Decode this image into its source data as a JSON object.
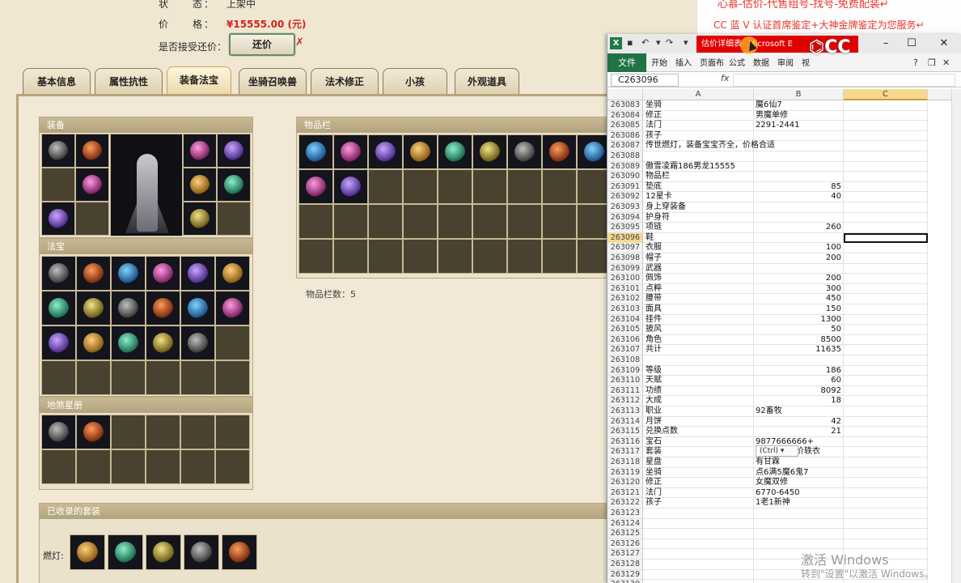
{
  "game": {
    "status_label": "状　　态：",
    "status_value": "上架中",
    "price_label": "价　　格：",
    "price_value": "¥15555.00 (元)",
    "counter_label": "是否接受还价：",
    "counter_button": "还价",
    "counter_x": "✗",
    "tabs": [
      "基本信息",
      "属性抗性",
      "装备法宝",
      "坐骑召唤兽",
      "法术修正",
      "小孩",
      "外观道具"
    ],
    "active_tab": 2,
    "panels": {
      "equip": "装备",
      "fabao": "法宝",
      "disha": "地煞星册",
      "bag": "物品栏",
      "sets": "已收录的套装"
    },
    "bag_count": "物品栏数：5",
    "sets_label": "燃灯:"
  },
  "ad": {
    "line1": "心慕-估价-代售组号-找号-免费配装↵",
    "line2": "CC 蓝 V 认证首席鉴定+大神金牌鉴定为您服务↵"
  },
  "excel": {
    "logo": "X",
    "title_part1": "估价详细表",
    "title_part2": "Microsoft E",
    "ribbon_file": "文件",
    "ribbon_tabs": [
      "开始",
      "插入",
      "页面布",
      "公式",
      "数据",
      "审阅",
      "视"
    ],
    "namebox": "C263096",
    "fx": "fx",
    "col_a": "A",
    "col_b": "B",
    "col_c": "C",
    "ctrl_tag": "(Ctrl) ▾",
    "rows": [
      {
        "n": "263083",
        "a": "坐骑",
        "b": "魔6仙7"
      },
      {
        "n": "263084",
        "a": "修正",
        "b": "男魔单修"
      },
      {
        "n": "263085",
        "a": "法门",
        "b": "2291-2441"
      },
      {
        "n": "263086",
        "a": "孩子",
        "b": ""
      },
      {
        "n": "263087",
        "a": "传世燃灯，装备宝宝齐全，价格合适",
        "b": ""
      },
      {
        "n": "263088",
        "a": "",
        "b": ""
      },
      {
        "n": "263089",
        "a": "傲雪凌霜186男龙15555",
        "b": ""
      },
      {
        "n": "263090",
        "a": "物品栏",
        "b": ""
      },
      {
        "n": "263091",
        "a": "垫底",
        "b": "85"
      },
      {
        "n": "263092",
        "a": "12星卡",
        "b": "40"
      },
      {
        "n": "263093",
        "a": "身上穿装备",
        "b": ""
      },
      {
        "n": "263094",
        "a": "护身符",
        "b": ""
      },
      {
        "n": "263095",
        "a": "项链",
        "b": "260"
      },
      {
        "n": "263096",
        "a": "鞋",
        "b": ""
      },
      {
        "n": "263097",
        "a": "衣服",
        "b": "100"
      },
      {
        "n": "263098",
        "a": "帽子",
        "b": "200"
      },
      {
        "n": "263099",
        "a": "武器",
        "b": ""
      },
      {
        "n": "263100",
        "a": "佩饰",
        "b": "200"
      },
      {
        "n": "263101",
        "a": "点粹",
        "b": "300"
      },
      {
        "n": "263102",
        "a": "腰带",
        "b": "450"
      },
      {
        "n": "263103",
        "a": "面具",
        "b": "150"
      },
      {
        "n": "263104",
        "a": "挂件",
        "b": "1300"
      },
      {
        "n": "263105",
        "a": "披风",
        "b": "50"
      },
      {
        "n": "263106",
        "a": "角色",
        "b": "8500"
      },
      {
        "n": "263107",
        "a": "共计",
        "b": "11635"
      },
      {
        "n": "263108",
        "a": "",
        "b": ""
      },
      {
        "n": "263109",
        "a": "等级",
        "b": "186"
      },
      {
        "n": "263110",
        "a": "天赋",
        "b": "60"
      },
      {
        "n": "263111",
        "a": "功绩",
        "b": "8092"
      },
      {
        "n": "263112",
        "a": "大成",
        "b": "18"
      },
      {
        "n": "263113",
        "a": "职业",
        "b": "92畜牧"
      },
      {
        "n": "263114",
        "a": "月饼",
        "b": "42"
      },
      {
        "n": "263115",
        "a": "兑换点数",
        "b": "21"
      },
      {
        "n": "263116",
        "a": "宝石",
        "b": "9877666666+"
      },
      {
        "n": "263117",
        "a": "套装",
        "b": "传世容止无价轶衣"
      },
      {
        "n": "263118",
        "a": "星盘",
        "b": "有甘霖"
      },
      {
        "n": "263119",
        "a": "坐骑",
        "b": "点6满5魔6鬼7"
      },
      {
        "n": "263120",
        "a": "修正",
        "b": "女魔双修"
      },
      {
        "n": "263121",
        "a": "法门",
        "b": "6770-6450"
      },
      {
        "n": "263122",
        "a": "孩子",
        "b": "1老1新神"
      },
      {
        "n": "263123",
        "a": "",
        "b": ""
      },
      {
        "n": "263124",
        "a": "",
        "b": ""
      },
      {
        "n": "263125",
        "a": "",
        "b": ""
      },
      {
        "n": "263126",
        "a": "",
        "b": ""
      },
      {
        "n": "263127",
        "a": "",
        "b": ""
      },
      {
        "n": "263128",
        "a": "",
        "b": ""
      },
      {
        "n": "263129",
        "a": "",
        "b": ""
      },
      {
        "n": "263130",
        "a": "",
        "b": ""
      }
    ],
    "selected_row": "263096"
  },
  "watermark": {
    "line1": "激活 Windows",
    "line2": "转到\"设置\"以激活 Windows。"
  },
  "colors": {
    "price": "#d4241c",
    "excel_green": "#217346",
    "title_red": "#e10000"
  }
}
